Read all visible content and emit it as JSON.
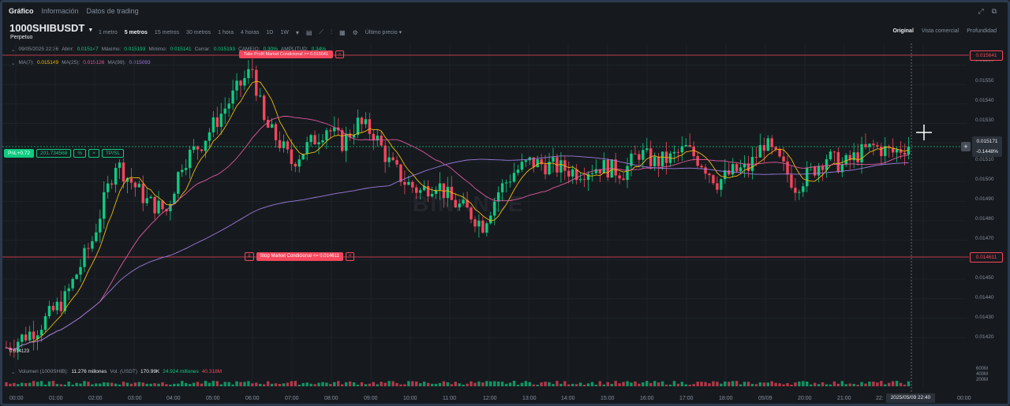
{
  "tabs": [
    {
      "label": "Gráfico",
      "active": true
    },
    {
      "label": "Información",
      "active": false
    },
    {
      "label": "Datos de trading",
      "active": false
    }
  ],
  "symbol": {
    "name": "1000SHIBUSDT",
    "type": "Perpetuo"
  },
  "intervals": [
    "1 metro",
    "5 metros",
    "15 metros",
    "30 metros",
    "1 hora",
    "4 horas",
    "1D",
    "1W"
  ],
  "active_interval": "5 metros",
  "price_type": "Último precio",
  "views": [
    {
      "label": "Original",
      "active": true
    },
    {
      "label": "Vista comercial",
      "active": false
    },
    {
      "label": "Profundidad",
      "active": false
    }
  ],
  "ohlc": {
    "date": "09/05/2025 22:36",
    "open_label": "Abrir:",
    "open": "0.015147",
    "high_label": "Máximo:",
    "high": "0.015193",
    "low_label": "Mínimo:",
    "low": "0.015141",
    "close_label": "Cerrar:",
    "close": "0.015193",
    "change_label": "CAMBIO:",
    "change": "0.30%",
    "amp_label": "AMPLITUD:",
    "amp": "0.34%"
  },
  "ma": {
    "ma7_label": "MA(7):",
    "ma7": "0.015149",
    "ma25_label": "MA(25):",
    "ma25": "0.015126",
    "ma99_label": "MA(99):",
    "ma99": "0.015093"
  },
  "position": {
    "pnl": "PnL+0.72",
    "size": "201.734568",
    "close": "%",
    "tpsl": "TP/SL"
  },
  "stop_order": {
    "label": "Stop Market Condicional <= 0.014611",
    "price": "0.014611"
  },
  "tp_order": {
    "label": "Take Profit Market Condicional >= 0.015641",
    "price": "0.015641"
  },
  "current_price": {
    "value": "0.015171",
    "change": "-0.1448%"
  },
  "low_marker": "0.014123",
  "watermark": "BINANCE",
  "y_axis": [
    "0.01560",
    "0.01550",
    "0.01540",
    "0.01530",
    "0.01510",
    "0.01500",
    "0.01490",
    "0.01480",
    "0.01470",
    "0.01450",
    "0.01440",
    "0.01430",
    "0.01420"
  ],
  "volume": {
    "label": "Volumen (1000SHIB):",
    "value": "11.276 millones",
    "vol_label": "Vol. (USDT)",
    "vol_value": "170.99K",
    "ma1": "24.924 millones",
    "ma2": "40.318M"
  },
  "volume_axis": [
    "600M",
    "400M",
    "200M"
  ],
  "x_axis": [
    "00:00",
    "01:00",
    "02:00",
    "03:00",
    "04:00",
    "05:00",
    "06:00",
    "07:00",
    "08:00",
    "09:00",
    "10:00",
    "11:00",
    "12:00",
    "13:00",
    "14:00",
    "15:00",
    "16:00",
    "17:00",
    "18:00",
    "05/09",
    "20:00",
    "21:00",
    "22:",
    "00:00"
  ],
  "x_cursor": "2025/05/09 22:40",
  "colors": {
    "up": "#0ecb81",
    "down": "#f6465d",
    "ma7": "#f0b90b",
    "ma25": "#e3589e",
    "ma99": "#9d7bde",
    "bg": "#161a1e"
  },
  "chart_data": {
    "type": "candlestick",
    "ylim": [
      0.0141,
      0.01565
    ],
    "anchors": [
      [
        0,
        0.01415
      ],
      [
        8,
        0.01425
      ],
      [
        15,
        0.0144
      ],
      [
        22,
        0.0147
      ],
      [
        28,
        0.0151
      ],
      [
        32,
        0.015
      ],
      [
        36,
        0.0149
      ],
      [
        41,
        0.01485
      ],
      [
        45,
        0.0151
      ],
      [
        50,
        0.0152
      ],
      [
        55,
        0.01535
      ],
      [
        60,
        0.0155
      ],
      [
        63,
        0.01558
      ],
      [
        66,
        0.0153
      ],
      [
        70,
        0.0152
      ],
      [
        73,
        0.0151
      ],
      [
        78,
        0.0152
      ],
      [
        82,
        0.01528
      ],
      [
        86,
        0.0152
      ],
      [
        90,
        0.0153
      ],
      [
        94,
        0.01525
      ],
      [
        98,
        0.0151
      ],
      [
        102,
        0.015
      ],
      [
        106,
        0.01495
      ],
      [
        110,
        0.015
      ],
      [
        114,
        0.0149
      ],
      [
        118,
        0.01485
      ],
      [
        122,
        0.01478
      ],
      [
        126,
        0.01495
      ],
      [
        130,
        0.01505
      ],
      [
        134,
        0.0151
      ],
      [
        140,
        0.01508
      ],
      [
        146,
        0.01505
      ],
      [
        152,
        0.01508
      ],
      [
        158,
        0.01505
      ],
      [
        162,
        0.01515
      ],
      [
        166,
        0.0151
      ],
      [
        170,
        0.01512
      ],
      [
        174,
        0.01517
      ],
      [
        178,
        0.0151
      ],
      [
        182,
        0.015
      ],
      [
        186,
        0.01505
      ],
      [
        190,
        0.01507
      ],
      [
        194,
        0.0152
      ],
      [
        198,
        0.0151
      ],
      [
        202,
        0.01498
      ],
      [
        206,
        0.01505
      ],
      [
        210,
        0.01513
      ],
      [
        214,
        0.01508
      ],
      [
        218,
        0.01514
      ],
      [
        222,
        0.01518
      ],
      [
        227,
        0.01515
      ],
      [
        231,
        0.01519
      ]
    ]
  }
}
